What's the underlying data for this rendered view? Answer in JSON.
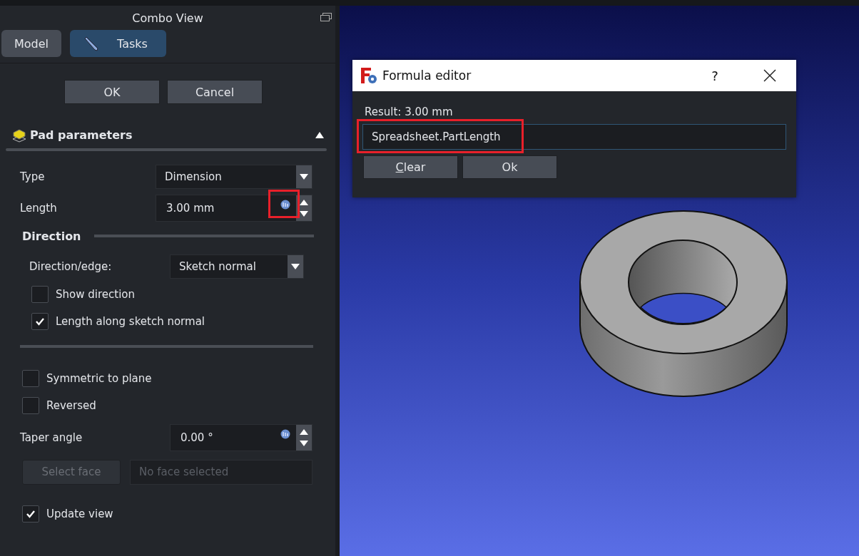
{
  "panel": {
    "title": "Combo View",
    "tabs": [
      {
        "label": "Model",
        "selected": false
      },
      {
        "label": "Tasks",
        "selected": true
      }
    ],
    "buttons": [
      "OK",
      "Cancel"
    ],
    "section": {
      "title": "Pad parameters",
      "expanded": true
    },
    "type": {
      "label": "Type",
      "value": "Dimension"
    },
    "length": {
      "label": "Length",
      "value": "3.00 mm",
      "highlighted": true
    },
    "direction": {
      "title": "Direction",
      "edge_label": "Direction/edge:",
      "edge_value": "Sketch normal",
      "checkboxes": [
        {
          "label": "Show direction",
          "checked": false
        },
        {
          "label": "Length along sketch normal",
          "checked": true
        }
      ]
    },
    "options": [
      {
        "label": "Symmetric to plane",
        "checked": false
      },
      {
        "label": "Reversed",
        "checked": false
      }
    ],
    "taper": {
      "label": "Taper angle",
      "value": "0.00 °"
    },
    "select_face": {
      "button": "Select face",
      "placeholder": "No face selected",
      "disabled": true
    },
    "update_view": {
      "label": "Update view",
      "checked": true
    }
  },
  "dialog": {
    "title": "Formula editor",
    "help": "?",
    "result": "Result: 3.00 mm",
    "value": "Spreadsheet.PartLength",
    "highlighted": true,
    "buttons": [
      "Clear",
      "Ok"
    ]
  }
}
